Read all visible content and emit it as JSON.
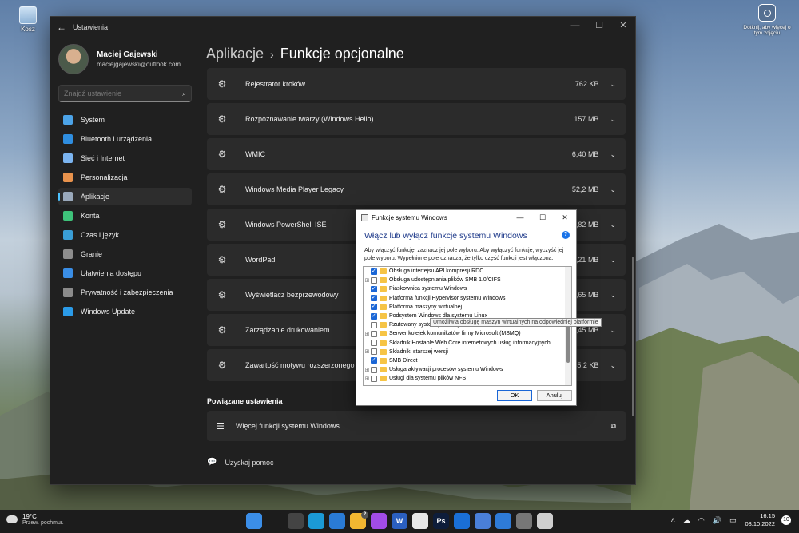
{
  "desktop": {
    "recycle_bin_label": "Kosz",
    "camera_widget_label": "Dotknij, aby więcej o tym zdjęciu"
  },
  "settings": {
    "window_title": "Ustawienia",
    "controls": {
      "minimize": "—",
      "maximize": "☐",
      "close": "✕"
    },
    "user": {
      "name": "Maciej Gajewski",
      "email": "maciejgajewski@outlook.com"
    },
    "search": {
      "placeholder": "Znajdź ustawienie"
    },
    "nav": [
      {
        "label": "System",
        "icon": "monitor-icon",
        "color": "#4ca3e8"
      },
      {
        "label": "Bluetooth i urządzenia",
        "icon": "bluetooth-icon",
        "color": "#2f8ee0"
      },
      {
        "label": "Sieć i Internet",
        "icon": "wifi-icon",
        "color": "#7bb4f0"
      },
      {
        "label": "Personalizacja",
        "icon": "brush-icon",
        "color": "#e8924c"
      },
      {
        "label": "Aplikacje",
        "icon": "apps-icon",
        "color": "#9aa9bb"
      },
      {
        "label": "Konta",
        "icon": "person-icon",
        "color": "#3ec27a"
      },
      {
        "label": "Czas i język",
        "icon": "globe-clock-icon",
        "color": "#3a9ed6"
      },
      {
        "label": "Granie",
        "icon": "gamepad-icon",
        "color": "#8d8d8d"
      },
      {
        "label": "Ułatwienia dostępu",
        "icon": "accessibility-icon",
        "color": "#3a8ee6"
      },
      {
        "label": "Prywatność i zabezpieczenia",
        "icon": "shield-icon",
        "color": "#8b8b8b"
      },
      {
        "label": "Windows Update",
        "icon": "update-icon",
        "color": "#2b9be8"
      }
    ],
    "active_nav": "Aplikacje",
    "breadcrumb": {
      "parent": "Aplikacje",
      "separator": "›",
      "current": "Funkcje opcjonalne"
    },
    "features": [
      {
        "name": "Rejestrator kroków",
        "size": "762 KB"
      },
      {
        "name": "Rozpoznawanie twarzy (Windows Hello)",
        "size": "157 MB"
      },
      {
        "name": "WMIC",
        "size": "6,40 MB"
      },
      {
        "name": "Windows Media Player Legacy",
        "size": "52,2 MB"
      },
      {
        "name": "Windows PowerShell ISE",
        "size": "6,82 MB"
      },
      {
        "name": "WordPad",
        "size": "6,21 MB"
      },
      {
        "name": "Wyświetlacz bezprzewodowy",
        "size": "5,65 MB"
      },
      {
        "name": "Zarządzanie drukowaniem",
        "size": "2,45 MB"
      },
      {
        "name": "Zawartość motywu rozszerzonego",
        "size": "45,2 KB"
      }
    ],
    "related_title": "Powiązane ustawienia",
    "related_item": "Więcej funkcji systemu Windows",
    "help": "Uzyskaj pomoc"
  },
  "dialog": {
    "title": "Funkcje systemu Windows",
    "heading": "Włącz lub wyłącz funkcje systemu Windows",
    "help_glyph": "?",
    "description": "Aby włączyć funkcję, zaznacz jej pole wyboru. Aby wyłączyć funkcję, wyczyść jej pole wyboru. Wypełnione pole oznacza, że tylko część funkcji jest włączona.",
    "features": [
      {
        "label": "Obsługa interfejsu API kompresji RDC",
        "checked": true,
        "expandable": false
      },
      {
        "label": "Obsługa udostępniania plików SMB 1.0/CIFS",
        "checked": false,
        "expandable": true
      },
      {
        "label": "Piaskownica systemu Windows",
        "checked": true,
        "expandable": false
      },
      {
        "label": "Platforma funkcji Hypervisor systemu Windows",
        "checked": true,
        "expandable": false
      },
      {
        "label": "Platforma maszyny wirtualnej",
        "checked": true,
        "expandable": false
      },
      {
        "label": "Podsystem Windows dla systemu Linux",
        "checked": true,
        "expandable": false
      },
      {
        "label": "Rzutowany system plików systemu Windows",
        "checked": false,
        "expandable": false
      },
      {
        "label": "Serwer kolejek komunikatów firmy Microsoft (MSMQ)",
        "checked": false,
        "expandable": true
      },
      {
        "label": "Składnik Hostable Web Core internetowych usług informacyjnych",
        "checked": false,
        "expandable": false
      },
      {
        "label": "Składniki starszej wersji",
        "checked": false,
        "expandable": true
      },
      {
        "label": "SMB Direct",
        "checked": true,
        "expandable": false
      },
      {
        "label": "Usługa aktywacji procesów systemu Windows",
        "checked": false,
        "expandable": true
      },
      {
        "label": "Usługi dla systemu plików NFS",
        "checked": false,
        "expandable": true
      }
    ],
    "tooltip": "Umożliwia obsługę maszyn wirtualnych na odpowiedniej platformie",
    "ok_label": "OK",
    "cancel_label": "Anuluj"
  },
  "taskbar": {
    "weather": {
      "temp": "19°C",
      "desc": "Przew. pochmur."
    },
    "apps": [
      {
        "name": "start-icon",
        "color": "#3b8ee8",
        "badge": ""
      },
      {
        "name": "search-icon",
        "color": "#1c1c1c",
        "badge": ""
      },
      {
        "name": "task-view-icon",
        "color": "#444444",
        "badge": ""
      },
      {
        "name": "edge-icon",
        "color": "#1b9ad6",
        "badge": ""
      },
      {
        "name": "mail-icon",
        "color": "#2a7bd6",
        "badge": ""
      },
      {
        "name": "file-explorer-icon",
        "color": "#f2b731",
        "badge": "2"
      },
      {
        "name": "messenger-icon",
        "color": "#a24ce8",
        "badge": ""
      },
      {
        "name": "word-icon",
        "color": "#2b5fc0",
        "badge": ""
      },
      {
        "name": "slack-icon",
        "color": "#e8e8e8",
        "badge": ""
      },
      {
        "name": "photoshop-icon",
        "color": "#0e1d3a",
        "badge": ""
      },
      {
        "name": "trello-icon",
        "color": "#1a6fd6",
        "badge": ""
      },
      {
        "name": "translator-icon",
        "color": "#4a7fd8",
        "badge": ""
      },
      {
        "name": "defender-icon",
        "color": "#2e7bd8",
        "badge": ""
      },
      {
        "name": "settings-icon",
        "color": "#777777",
        "badge": ""
      },
      {
        "name": "notepad-icon",
        "color": "#cfcfcf",
        "badge": ""
      }
    ],
    "app_glyphs": {
      "word-icon": "W",
      "photoshop-icon": "Ps"
    },
    "clock": {
      "time": "16:15",
      "date": "08.10.2022"
    },
    "notifications": "10"
  }
}
